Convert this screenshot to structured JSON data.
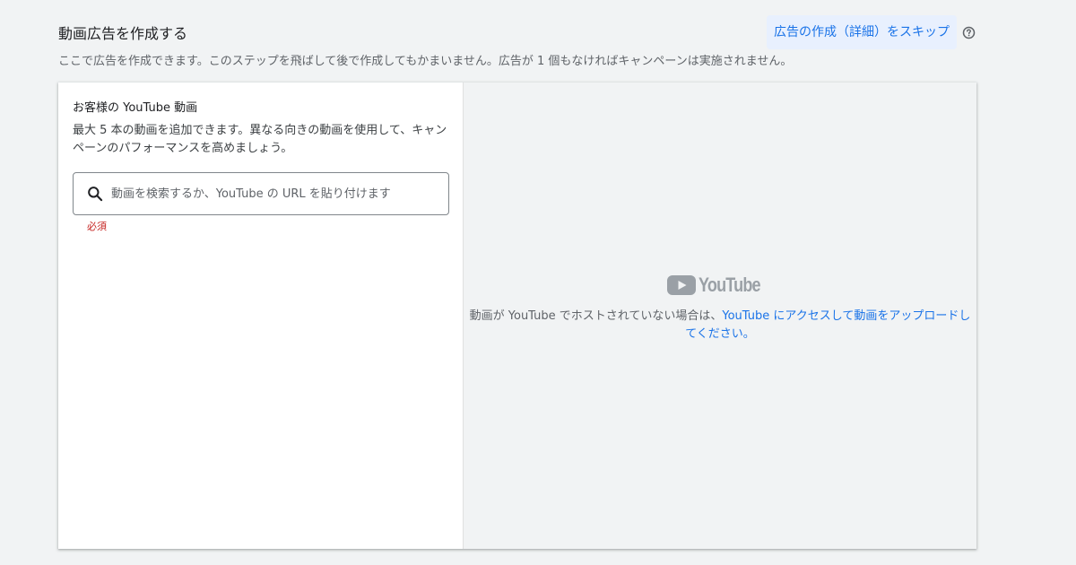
{
  "header": {
    "title": "動画広告を作成する",
    "skip_button_label": "広告の作成（詳細）をスキップ",
    "help_icon": "help-circle-icon",
    "description": "ここで広告を作成できます。このステップを飛ばして後で作成してもかまいません。広告が 1 個もなければキャンペーンは実施されません。"
  },
  "left_panel": {
    "title": "お客様の YouTube 動画",
    "description": "最大 5 本の動画を追加できます。異なる向きの動画を使用して、キャンペーンのパフォーマンスを高めましょう。",
    "search": {
      "icon": "search-icon",
      "placeholder": "動画を検索するか、YouTube の URL を貼り付けます",
      "value": ""
    },
    "required_label": "必須"
  },
  "right_panel": {
    "logo_text": "YouTube",
    "message_prefix": "動画が YouTube でホストされていない場合は、",
    "message_link": "YouTube にアクセスして動画をアップロードしてください。"
  },
  "colors": {
    "accent": "#1a73e8",
    "required": "#c5221f",
    "background": "#f1f3f4"
  }
}
